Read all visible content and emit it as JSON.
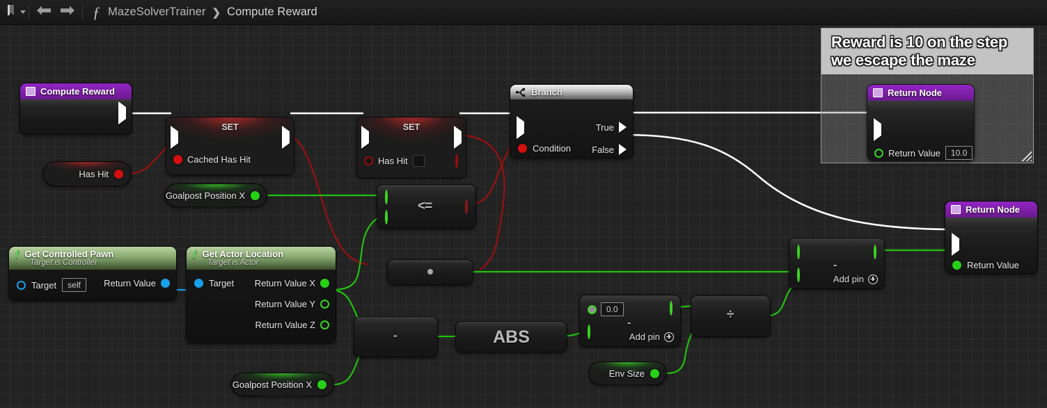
{
  "toolbar": {
    "bookmark_icon": "bookmark-icon",
    "dropdown_icon": "chevron-down-icon",
    "back_icon": "back-arrow-icon",
    "forward_icon": "forward-arrow-icon",
    "function_icon": "function-fx-icon",
    "breadcrumb": {
      "root": "MazeSolverTrainer",
      "separator": "❯",
      "current": "Compute Reward"
    }
  },
  "comment": {
    "text": "Reward is 10 on the step we escape the maze"
  },
  "nodes": {
    "entry": {
      "title": "Compute Reward",
      "icon": "function-entry-icon"
    },
    "set_cached_has_hit": {
      "title": "SET",
      "pin_label": "Cached Has Hit"
    },
    "set_has_hit": {
      "title": "SET",
      "pin_label": "Has Hit",
      "value": ""
    },
    "branch": {
      "title": "Branch",
      "icon": "branch-icon",
      "condition_label": "Condition",
      "true_label": "True",
      "false_label": "False"
    },
    "return_top": {
      "title": "Return Node",
      "icon": "function-result-icon",
      "return_value_label": "Return Value",
      "return_value": "10.0"
    },
    "return_bottom": {
      "title": "Return Node",
      "icon": "function-result-icon",
      "return_value_label": "Return Value"
    },
    "var_has_hit": {
      "label": "Has Hit"
    },
    "var_goalpost_top": {
      "label": "Goalpost Position X"
    },
    "var_goalpost_bottom": {
      "label": "Goalpost Position X"
    },
    "var_env_size": {
      "label": "Env Size"
    },
    "cmp_lessequal": {
      "symbol": "<="
    },
    "select_node": {
      "symbol": "•"
    },
    "get_controlled_pawn": {
      "title": "Get Controlled Pawn",
      "subtitle": "Target is Controller",
      "icon": "function-fx-icon",
      "target_label": "Target",
      "target_value": "self",
      "return_value_label": "Return Value"
    },
    "get_actor_location": {
      "title": "Get Actor Location",
      "subtitle": "Target is Actor",
      "icon": "function-fx-icon",
      "target_label": "Target",
      "return_x_label": "Return Value X",
      "return_y_label": "Return Value Y",
      "return_z_label": "Return Value Z"
    },
    "sub_bottom": {
      "symbol": "-"
    },
    "abs_node": {
      "symbol": "ABS"
    },
    "sub_literal": {
      "symbol": "-",
      "literal": "0.0",
      "add_pin_label": "Add pin",
      "add_pin_icon": "plus-circle-icon"
    },
    "divide_node": {
      "symbol": "÷"
    },
    "sub_final": {
      "symbol": "-",
      "add_pin_label": "Add pin",
      "add_pin_icon": "plus-circle-icon"
    }
  },
  "colors": {
    "canvas_bg": "#232323",
    "exec_wire": "#ffffff",
    "bool_wire": "#9b1010",
    "float_wire": "#22c20f",
    "object_wire": "#18a0e8",
    "node_purple": "#9325c4",
    "pin_red": "#d40f0f",
    "pin_green": "#27d117",
    "pin_blue": "#18a0e8"
  }
}
